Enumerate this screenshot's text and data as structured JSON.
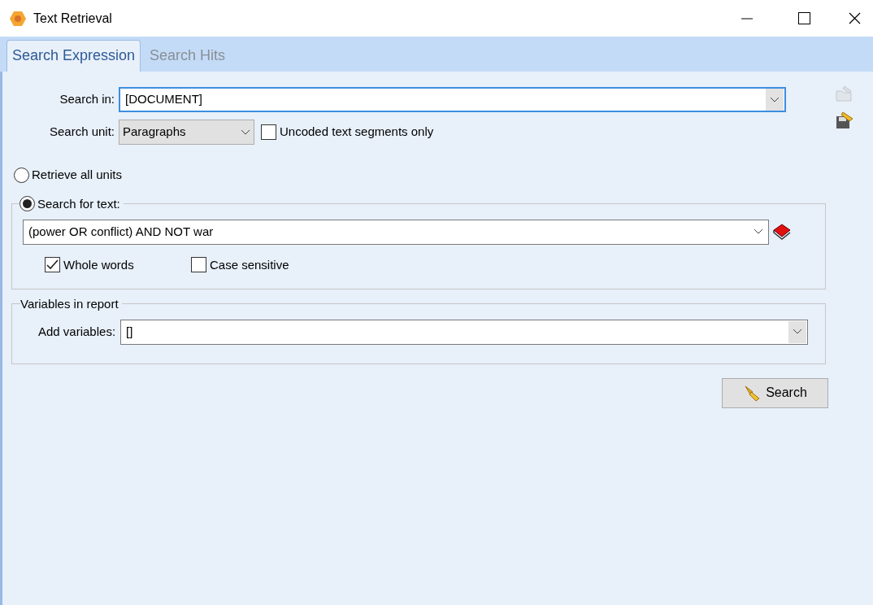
{
  "window": {
    "title": "Text Retrieval"
  },
  "tabs": [
    {
      "label": "Search Expression",
      "selected": true
    },
    {
      "label": "Search Hits",
      "selected": false
    }
  ],
  "search_in": {
    "label": "Search in:",
    "value": "[DOCUMENT]"
  },
  "search_unit": {
    "label": "Search unit:",
    "value": "Paragraphs"
  },
  "uncoded_only": {
    "label": "Uncoded text segments only",
    "checked": false
  },
  "mode_options": [
    {
      "label": "Retrieve all units",
      "selected": false
    },
    {
      "label": "Search for text:",
      "selected": true
    }
  ],
  "search_text": {
    "value": "(power OR conflict) AND NOT war"
  },
  "options": [
    {
      "label": "Whole words",
      "checked": true
    },
    {
      "label": "Case sensitive",
      "checked": false
    }
  ],
  "variables": {
    "title": "Variables in report",
    "label": "Add variables:",
    "value": "[]"
  },
  "buttons": [
    {
      "label": "Search"
    }
  ],
  "toolbar": [
    {
      "disabled": true
    },
    {
      "disabled": false
    }
  ]
}
